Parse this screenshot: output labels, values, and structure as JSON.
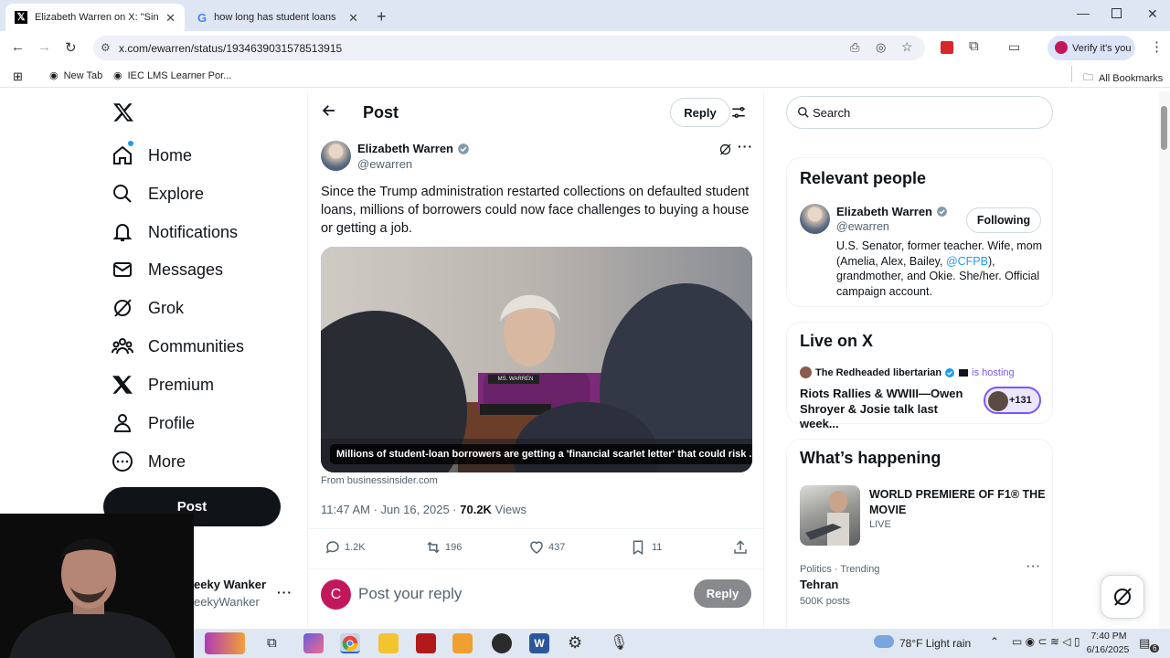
{
  "browser": {
    "tabs": [
      {
        "title": "Elizabeth Warren on X: \"Since th",
        "active": true
      },
      {
        "title": "how long has student loans bee",
        "active": false
      }
    ],
    "url": "x.com/ewarren/status/1934639031578513915",
    "verify_label": "Verify it's you",
    "bookmarks": [
      "New Tab",
      "IEC LMS Learner Por..."
    ],
    "all_bookmarks": "All Bookmarks"
  },
  "nav": {
    "items": [
      "Home",
      "Explore",
      "Notifications",
      "Messages",
      "Grok",
      "Communities",
      "Premium",
      "Profile",
      "More"
    ],
    "post_button": "Post",
    "account_name": "eeky Wanker",
    "account_handle": "eekyWanker"
  },
  "header": {
    "title": "Post",
    "reply_button": "Reply"
  },
  "post": {
    "author_name": "Elizabeth Warren",
    "author_handle": "@ewarren",
    "text": "Since the Trump administration restarted collections on defaulted student loans, millions of borrowers could now face challenges to buying a house or getting a job.",
    "card_caption": "Millions of student-loan borrowers are getting a 'financial scarlet letter' that could risk ...",
    "nameplate": "MS. WARREN",
    "card_source": "From businessinsider.com",
    "timestamp": "11:47 AM · Jun 16, 2025 · ",
    "views_count": "70.2K",
    "views_label": " Views",
    "replies": "1.2K",
    "reposts": "196",
    "likes": "437",
    "bookmarks": "11"
  },
  "reply_box": {
    "avatar_letter": "C",
    "placeholder": "Post your reply",
    "button": "Reply"
  },
  "search": {
    "placeholder": "Search"
  },
  "relevant_people": {
    "heading": "Relevant people",
    "name": "Elizabeth Warren",
    "handle": "@ewarren",
    "follow_label": "Following",
    "bio_1": "U.S. Senator, former teacher. Wife, mom (Amelia, Alex, Bailey, ",
    "bio_link": "@CFPB",
    "bio_2": "), grandmother, and Okie. She/her. Official campaign account."
  },
  "live": {
    "heading": "Live on X",
    "host": "The Redheaded libertarian",
    "hosting": "is hosting",
    "title": "Riots Rallies & WWIII—Owen Shroyer & Josie talk last week...",
    "count": "+131"
  },
  "happening": {
    "heading": "What’s happening",
    "item1_title": "WORLD PREMIERE OF F1® THE MOVIE",
    "item1_status": "LIVE",
    "item2_meta": "Politics · Trending",
    "item2_title": "Tehran",
    "item2_posts": "500K posts"
  },
  "taskbar": {
    "weather": "78°F  Light rain",
    "time": "7:40 PM",
    "date": "6/16/2025",
    "notif_count": "6"
  },
  "colors": {
    "accent": "#1d9bf0",
    "text": "#0f1419",
    "muted": "#536471",
    "live": "#7856ff"
  }
}
